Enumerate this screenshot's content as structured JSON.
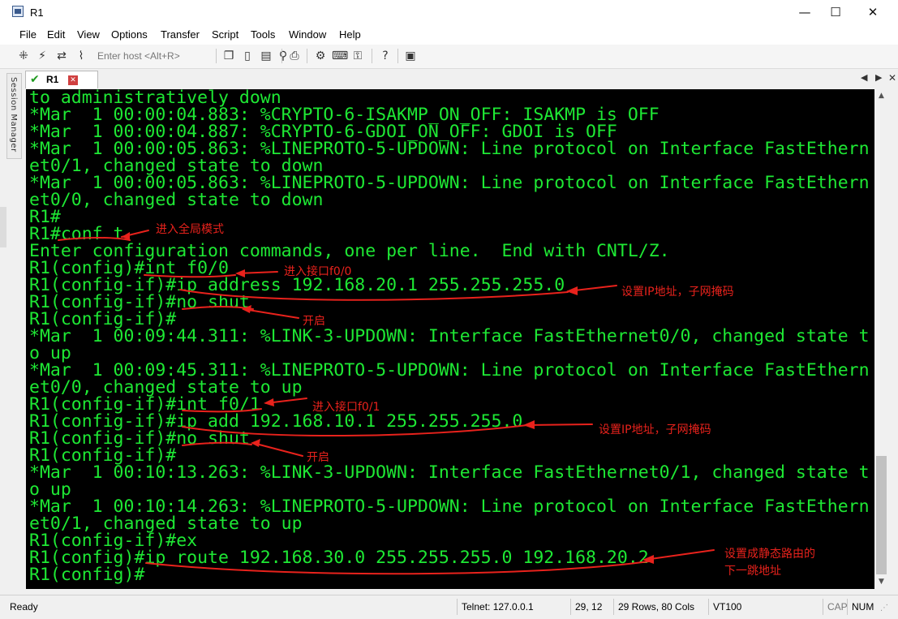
{
  "window": {
    "title": "R1",
    "icons": [
      "app-icon",
      "minimize-icon",
      "maximize-icon",
      "close-icon"
    ]
  },
  "menu": [
    "File",
    "Edit",
    "View",
    "Options",
    "Transfer",
    "Script",
    "Tools",
    "Window",
    "Help"
  ],
  "toolbar": {
    "host_placeholder": "Enter host <Alt+R>",
    "icons": [
      "connect-icon",
      "quick-connect-icon",
      "reconnect-icon",
      "disconnect-icon",
      "copy-icon",
      "paste-icon",
      "clipboard-icon",
      "find-icon",
      "print-icon",
      "settings-icon",
      "keymap-icon",
      "key-icon",
      "help-icon",
      "sftp-icon"
    ]
  },
  "session_manager": {
    "label": "Session Manager"
  },
  "tab": {
    "label": "R1",
    "status_icon": "check-icon",
    "close_icon": "close-icon"
  },
  "terminal": {
    "lines": [
      "to administratively down",
      "*Mar  1 00:00:04.883: %CRYPTO-6-ISAKMP_ON_OFF: ISAKMP is OFF",
      "*Mar  1 00:00:04.887: %CRYPTO-6-GDOI_ON_OFF: GDOI is OFF",
      "*Mar  1 00:00:05.863: %LINEPROTO-5-UPDOWN: Line protocol on Interface FastEthern",
      "et0/1, changed state to down",
      "*Mar  1 00:00:05.863: %LINEPROTO-5-UPDOWN: Line protocol on Interface FastEthern",
      "et0/0, changed state to down",
      "R1#",
      "R1#conf t",
      "Enter configuration commands, one per line.  End with CNTL/Z.",
      "R1(config)#int f0/0",
      "R1(config-if)#ip address 192.168.20.1 255.255.255.0",
      "R1(config-if)#no shut",
      "R1(config-if)#",
      "*Mar  1 00:09:44.311: %LINK-3-UPDOWN: Interface FastEthernet0/0, changed state t",
      "o up",
      "*Mar  1 00:09:45.311: %LINEPROTO-5-UPDOWN: Line protocol on Interface FastEthern",
      "et0/0, changed state to up",
      "R1(config-if)#int f0/1",
      "R1(config-if)#ip add 192.168.10.1 255.255.255.0",
      "R1(config-if)#no shut",
      "R1(config-if)#",
      "*Mar  1 00:10:13.263: %LINK-3-UPDOWN: Interface FastEthernet0/1, changed state t",
      "o up",
      "*Mar  1 00:10:14.263: %LINEPROTO-5-UPDOWN: Line protocol on Interface FastEthern",
      "et0/1, changed state to up",
      "R1(config-if)#ex",
      "R1(config)#ip route 192.168.30.0 255.255.255.0 192.168.20.2",
      "R1(config)#"
    ],
    "text_color": "#1ee834",
    "background": "#000000"
  },
  "annotations": {
    "color": "#e8221c",
    "global_mode": "进入全局模式",
    "enter_f00": "进入接口f0/0",
    "set_ip_1": "设置IP地址，子网掩码",
    "enable_1": "开启",
    "enter_f01": "进入接口f0/1",
    "set_ip_2": "设置IP地址，子网掩码",
    "enable_2": "开启",
    "static_route_1": "设置成静态路由的",
    "static_route_2": "下一跳地址"
  },
  "status": {
    "ready": "Ready",
    "connection": "Telnet: 127.0.0.1",
    "cursor": "29,  12",
    "size": "29 Rows, 80 Cols",
    "emulation": "VT100",
    "caps": "CAP",
    "num": "NUM"
  }
}
